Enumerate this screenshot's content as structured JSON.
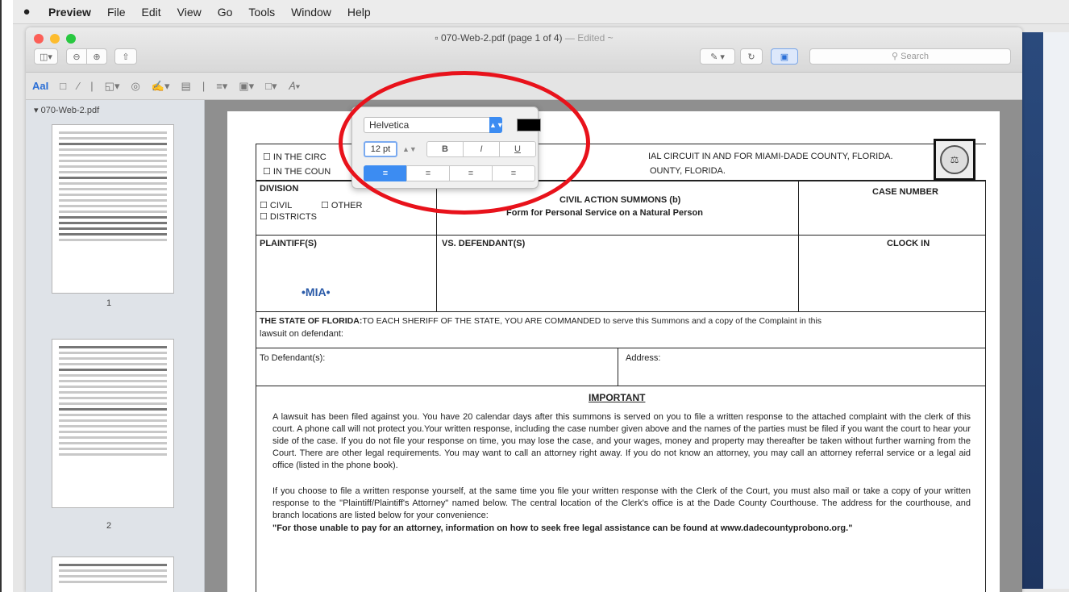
{
  "menubar": {
    "apple": "",
    "items": [
      "Preview",
      "File",
      "Edit",
      "View",
      "Go",
      "Tools",
      "Window",
      "Help"
    ]
  },
  "window": {
    "title": "070-Web-2.pdf (page 1 of 4)",
    "edited": "— Edited ~",
    "search_placeholder": "Search"
  },
  "markup": {
    "text_style": "AaI"
  },
  "sidebar": {
    "file": "070-Web-2.pdf",
    "pages": [
      "1",
      "2"
    ]
  },
  "font_popover": {
    "font": "Helvetica",
    "size": "12 pt",
    "bold": "B",
    "italic": "I",
    "underline": "U",
    "align_left": "≡",
    "align_center": "≡",
    "align_right": "≡",
    "align_justify": "≡",
    "colors": {
      "text_color": "#000000",
      "accent": "#3c8cf2",
      "annotation_ring": "#e8121b"
    }
  },
  "form": {
    "court_circuit": "☐ IN THE CIRCUIT COURT OF THE ELEVENTH JUDICIAL CIRCUIT IN AND FOR MIAMI-DADE COUNTY, FLORIDA.",
    "court_circuit_tail": "IAL CIRCUIT IN AND FOR MIAMI-DADE COUNTY, FLORIDA.",
    "court_circuit_head": "☐ IN THE CIRC",
    "court_county_head": "☐ IN THE COUN",
    "court_county_tail": "OUNTY, FLORIDA.",
    "division": "DIVISION",
    "civil": "☐ CIVIL",
    "other": "☐ OTHER",
    "districts": "☐ DISTRICTS",
    "title": "CIVIL ACTION SUMMONS (b)",
    "subtitle": "Form for Personal Service on a Natural Person",
    "case_number": "CASE NUMBER",
    "plaintiff": "PLAINTIFF(S)",
    "vs": "VS.   DEFENDANT(S)",
    "clock_in": "CLOCK IN",
    "mia": "•MIA•",
    "state_line1_bold": "THE STATE OF FLORIDA:",
    "state_line1": "TO EACH SHERIFF OF THE STATE, YOU ARE COMMANDED to serve this Summons and a copy of the Complaint in this",
    "state_line2": "lawsuit on defendant:",
    "to_defendant": "To Defendant(s):",
    "address": "Address:",
    "important": "IMPORTANT",
    "para1": "A lawsuit has been filed against you. You have 20 calendar days after this summons is served on you to file a written response to the attached complaint with the clerk of this court. A phone call will not protect you.Your written response, including the case number given above and the names of the parties must be filed if you want the court to hear your side of the case. If you do not file your response on time, you may lose the case, and your wages, money and property may thereafter be taken without further warning from the Court. There are other legal requirements. You may want to call an attorney right away. If you do not know an attorney, you may call an attorney referral service or a legal aid office (listed in the phone book).",
    "para2": "If you choose to file a written response yourself, at the same time you file your written response with the Clerk of the Court, you must also mail or take a copy of your written response to the \"Plaintiff/Plaintiff's Attorney\" named below. The central location of the Clerk's office is at the Dade County Courthouse. The address for the courthouse, and branch locations are listed below for your convenience:",
    "para3": "\"For those unable to pay for an attorney, information on how to seek free legal assistance can be found at www.dadecountyprobono.org.\""
  }
}
